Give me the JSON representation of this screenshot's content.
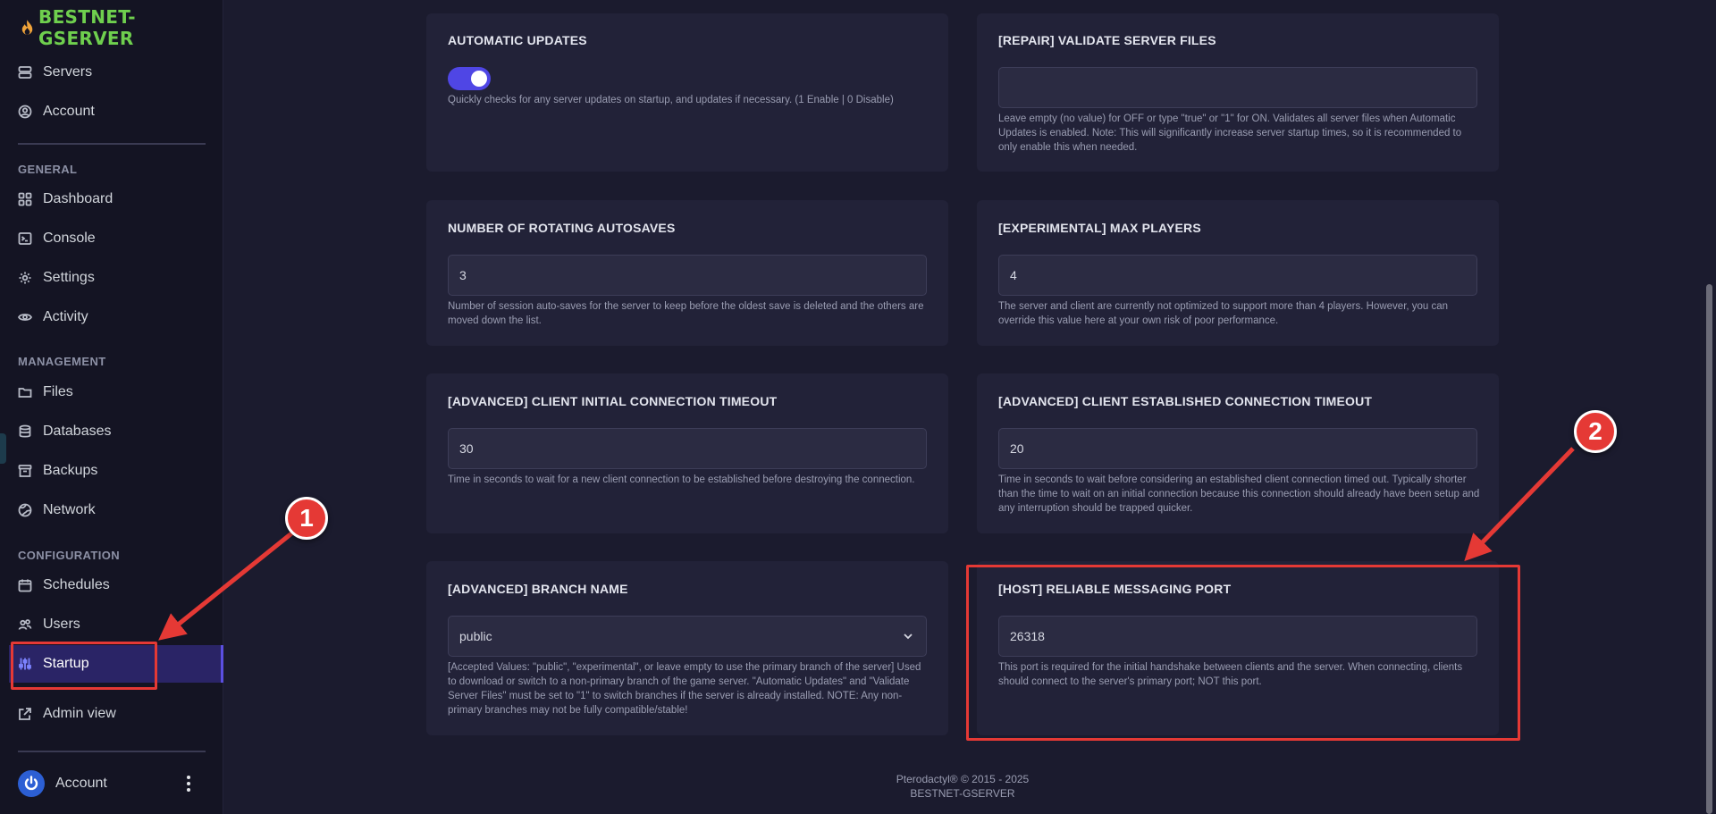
{
  "app": {
    "name": "BESTNET-GSERVER"
  },
  "sidebar": {
    "top_items": [
      {
        "label": "Servers",
        "icon": "server-icon"
      },
      {
        "label": "Account",
        "icon": "user-circle-icon"
      }
    ],
    "sections": [
      {
        "label": "GENERAL",
        "items": [
          {
            "label": "Dashboard",
            "icon": "grid-icon"
          },
          {
            "label": "Console",
            "icon": "terminal-icon"
          },
          {
            "label": "Settings",
            "icon": "gear-icon"
          },
          {
            "label": "Activity",
            "icon": "eye-icon"
          }
        ]
      },
      {
        "label": "MANAGEMENT",
        "items": [
          {
            "label": "Files",
            "icon": "folder-icon"
          },
          {
            "label": "Databases",
            "icon": "database-icon"
          },
          {
            "label": "Backups",
            "icon": "archive-icon"
          },
          {
            "label": "Network",
            "icon": "globe-icon"
          }
        ]
      },
      {
        "label": "CONFIGURATION",
        "items": [
          {
            "label": "Schedules",
            "icon": "calendar-icon"
          },
          {
            "label": "Users",
            "icon": "users-icon"
          },
          {
            "label": "Startup",
            "icon": "sliders-icon",
            "active": true
          }
        ]
      }
    ],
    "admin_view": "Admin view",
    "footer_account": "Account"
  },
  "cards": {
    "automatic_updates": {
      "title": "AUTOMATIC UPDATES",
      "toggle_on": true,
      "desc": "Quickly checks for any server updates on startup, and updates if necessary. (1 Enable | 0 Disable)"
    },
    "validate_files": {
      "title": "[REPAIR] VALIDATE SERVER FILES",
      "value": "",
      "desc": "Leave empty (no value) for OFF or type \"true\" or \"1\" for ON. Validates all server files when Automatic Updates is enabled. Note: This will significantly increase server startup times, so it is recommended to only enable this when needed."
    },
    "autosaves": {
      "title": "NUMBER OF ROTATING AUTOSAVES",
      "value": "3",
      "desc": "Number of session auto-saves for the server to keep before the oldest save is deleted and the others are moved down the list."
    },
    "max_players": {
      "title": "[EXPERIMENTAL] MAX PLAYERS",
      "value": "4",
      "desc": "The server and client are currently not optimized to support more than 4 players. However, you can override this value here at your own risk of poor performance."
    },
    "initial_timeout": {
      "title": "[ADVANCED] CLIENT INITIAL CONNECTION TIMEOUT",
      "value": "30",
      "desc": "Time in seconds to wait for a new client connection to be established before destroying the connection."
    },
    "established_timeout": {
      "title": "[ADVANCED] CLIENT ESTABLISHED CONNECTION TIMEOUT",
      "value": "20",
      "desc": "Time in seconds to wait before considering an established client connection timed out. Typically shorter than the time to wait on an initial connection because this connection should already have been setup and any interruption should be trapped quicker."
    },
    "branch_name": {
      "title": "[ADVANCED] BRANCH NAME",
      "value": "public",
      "desc": "[Accepted Values: \"public\", \"experimental\", or leave empty to use the primary branch of the server] Used to download or switch to a non-primary branch of the game server. \"Automatic Updates\" and \"Validate Server Files\" must be set to \"1\" to switch branches if the server is already installed. NOTE: Any non-primary branches may not be fully compatible/stable!"
    },
    "messaging_port": {
      "title": "[HOST] RELIABLE MESSAGING PORT",
      "value": "26318",
      "desc": "This port is required for the initial handshake between clients and the server. When connecting, clients should connect to the server's primary port; NOT this port."
    }
  },
  "footer": {
    "copyright": "Pterodactyl® © 2015 - 2025",
    "server": "BESTNET-GSERVER"
  },
  "annotations": {
    "badge_1": "1",
    "badge_2": "2",
    "color": "#e53935"
  },
  "colors": {
    "accent": "#4f46e5",
    "logo_green": "#6fcf4e",
    "bg": "#1b1b2e",
    "sidebar_bg": "#141423",
    "card_bg": "#222238"
  }
}
